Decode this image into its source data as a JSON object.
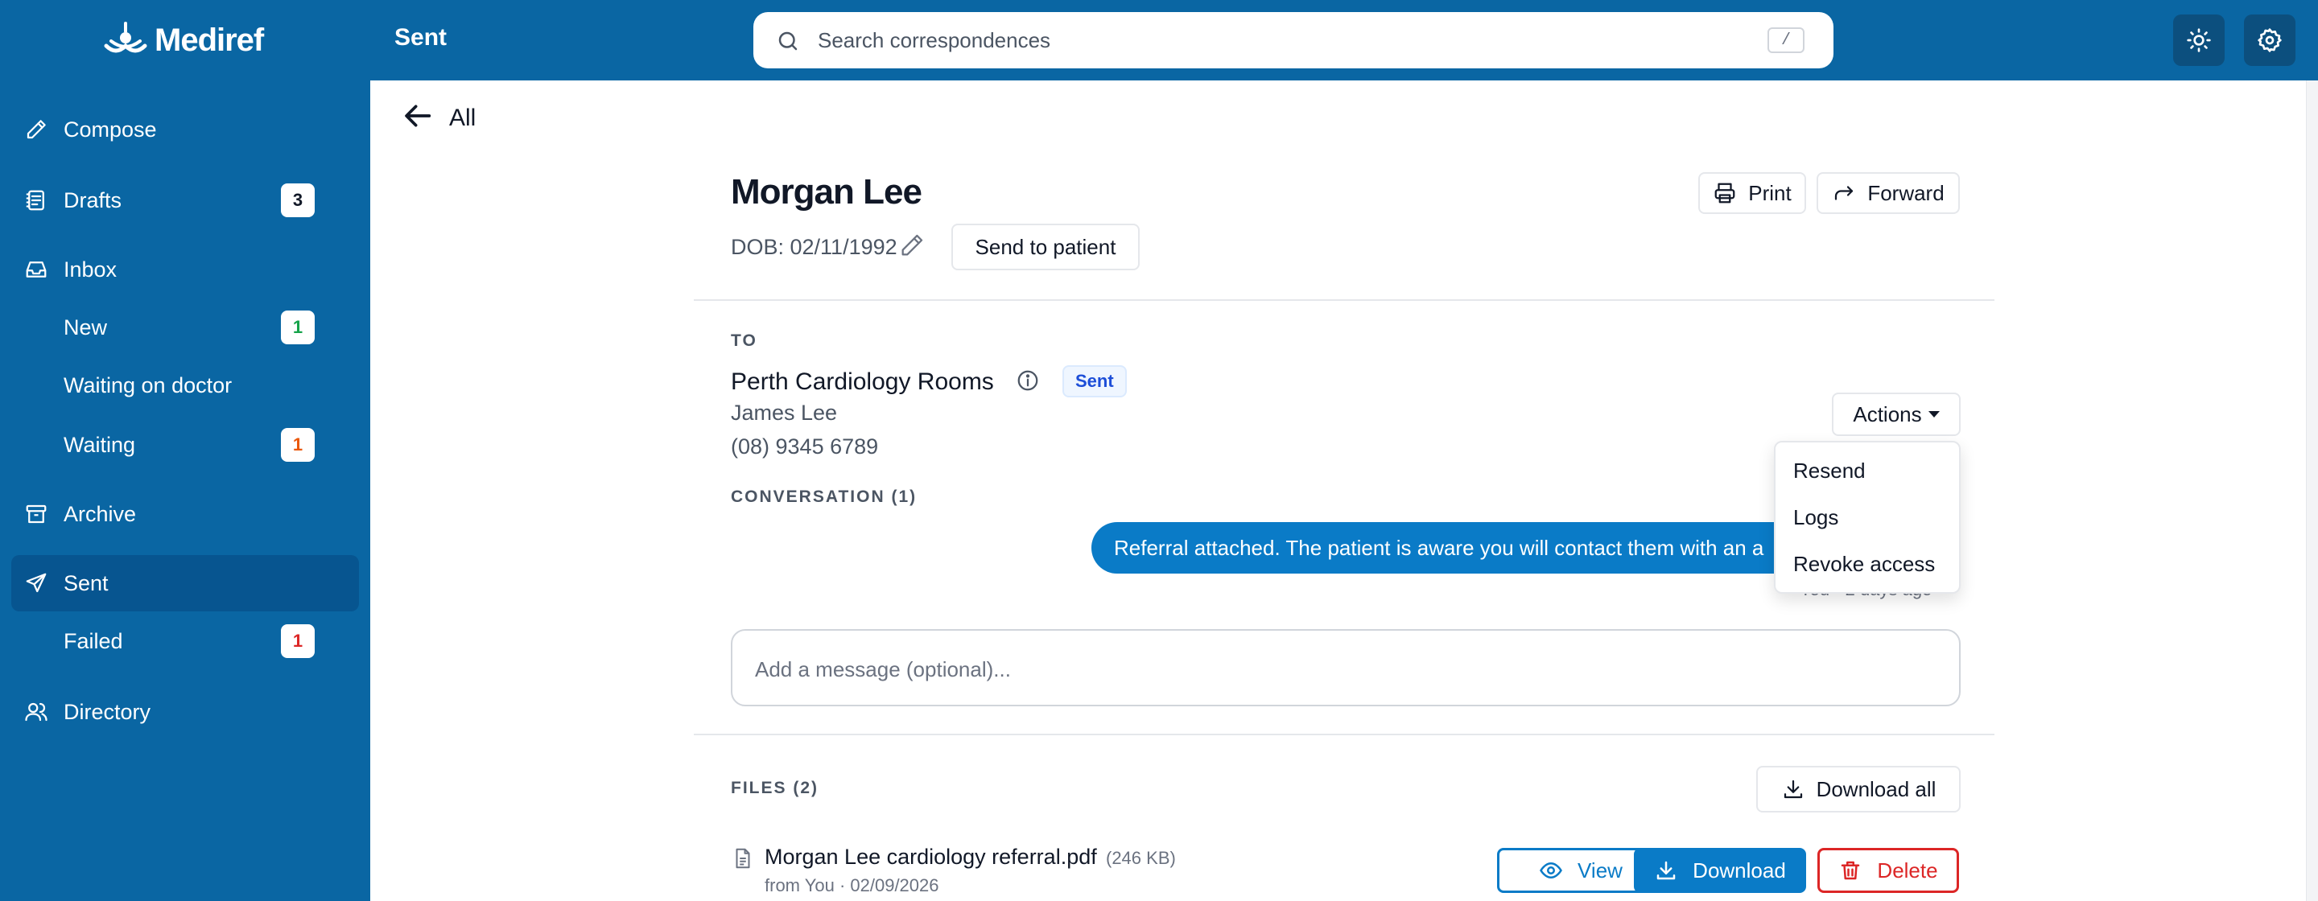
{
  "app": {
    "name": "Mediref",
    "page_heading": "Sent"
  },
  "search": {
    "placeholder": "Search correspondences",
    "shortcut": "/"
  },
  "sidebar": {
    "items": [
      {
        "label": "Compose",
        "icon": "pencil-icon"
      },
      {
        "label": "Drafts",
        "icon": "drafts-icon",
        "badge": "3"
      },
      {
        "label": "Inbox",
        "icon": "inbox-icon"
      },
      {
        "label": "New",
        "badge": "1"
      },
      {
        "label": "Waiting on doctor"
      },
      {
        "label": "Waiting",
        "badge": "1"
      },
      {
        "label": "Archive",
        "icon": "archive-icon"
      },
      {
        "label": "Sent",
        "icon": "send-icon",
        "active": true
      },
      {
        "label": "Failed",
        "badge": "1"
      },
      {
        "label": "Directory",
        "icon": "users-icon"
      }
    ]
  },
  "colors": {
    "brand": "#0a66a3",
    "accent": "#0a7bc7",
    "badge_new": "#16a34a",
    "badge_waiting": "#ea580c",
    "badge_failed": "#dc2626",
    "danger": "#dc2626"
  },
  "back": {
    "label": "All"
  },
  "patient": {
    "name": "Morgan Lee",
    "dob": "DOB: 02/11/1992"
  },
  "buttons": {
    "print": "Print",
    "forward": "Forward",
    "send_to_patient": "Send to patient",
    "actions": "Actions",
    "download_all": "Download all"
  },
  "recipient": {
    "section_label": "TO",
    "name": "Perth Cardiology Rooms",
    "status": "Sent",
    "contact": "James Lee",
    "phone": "(08) 9345 6789"
  },
  "actions_menu": {
    "items": [
      "Resend",
      "Logs",
      "Revoke access"
    ]
  },
  "conversation": {
    "section_label": "CONVERSATION (1)",
    "messages": [
      {
        "text": "Referral attached. The patient is aware you will contact them with an a",
        "meta": "You · 2 days ago"
      }
    ],
    "input_placeholder": "Add a message (optional)..."
  },
  "files": {
    "section_label": "FILES (2)",
    "items": [
      {
        "name": "Morgan Lee cardiology referral.pdf",
        "size": "(246 KB)",
        "meta": "from You · 02/09/2026"
      }
    ],
    "view": "View",
    "download": "Download",
    "delete": "Delete"
  }
}
